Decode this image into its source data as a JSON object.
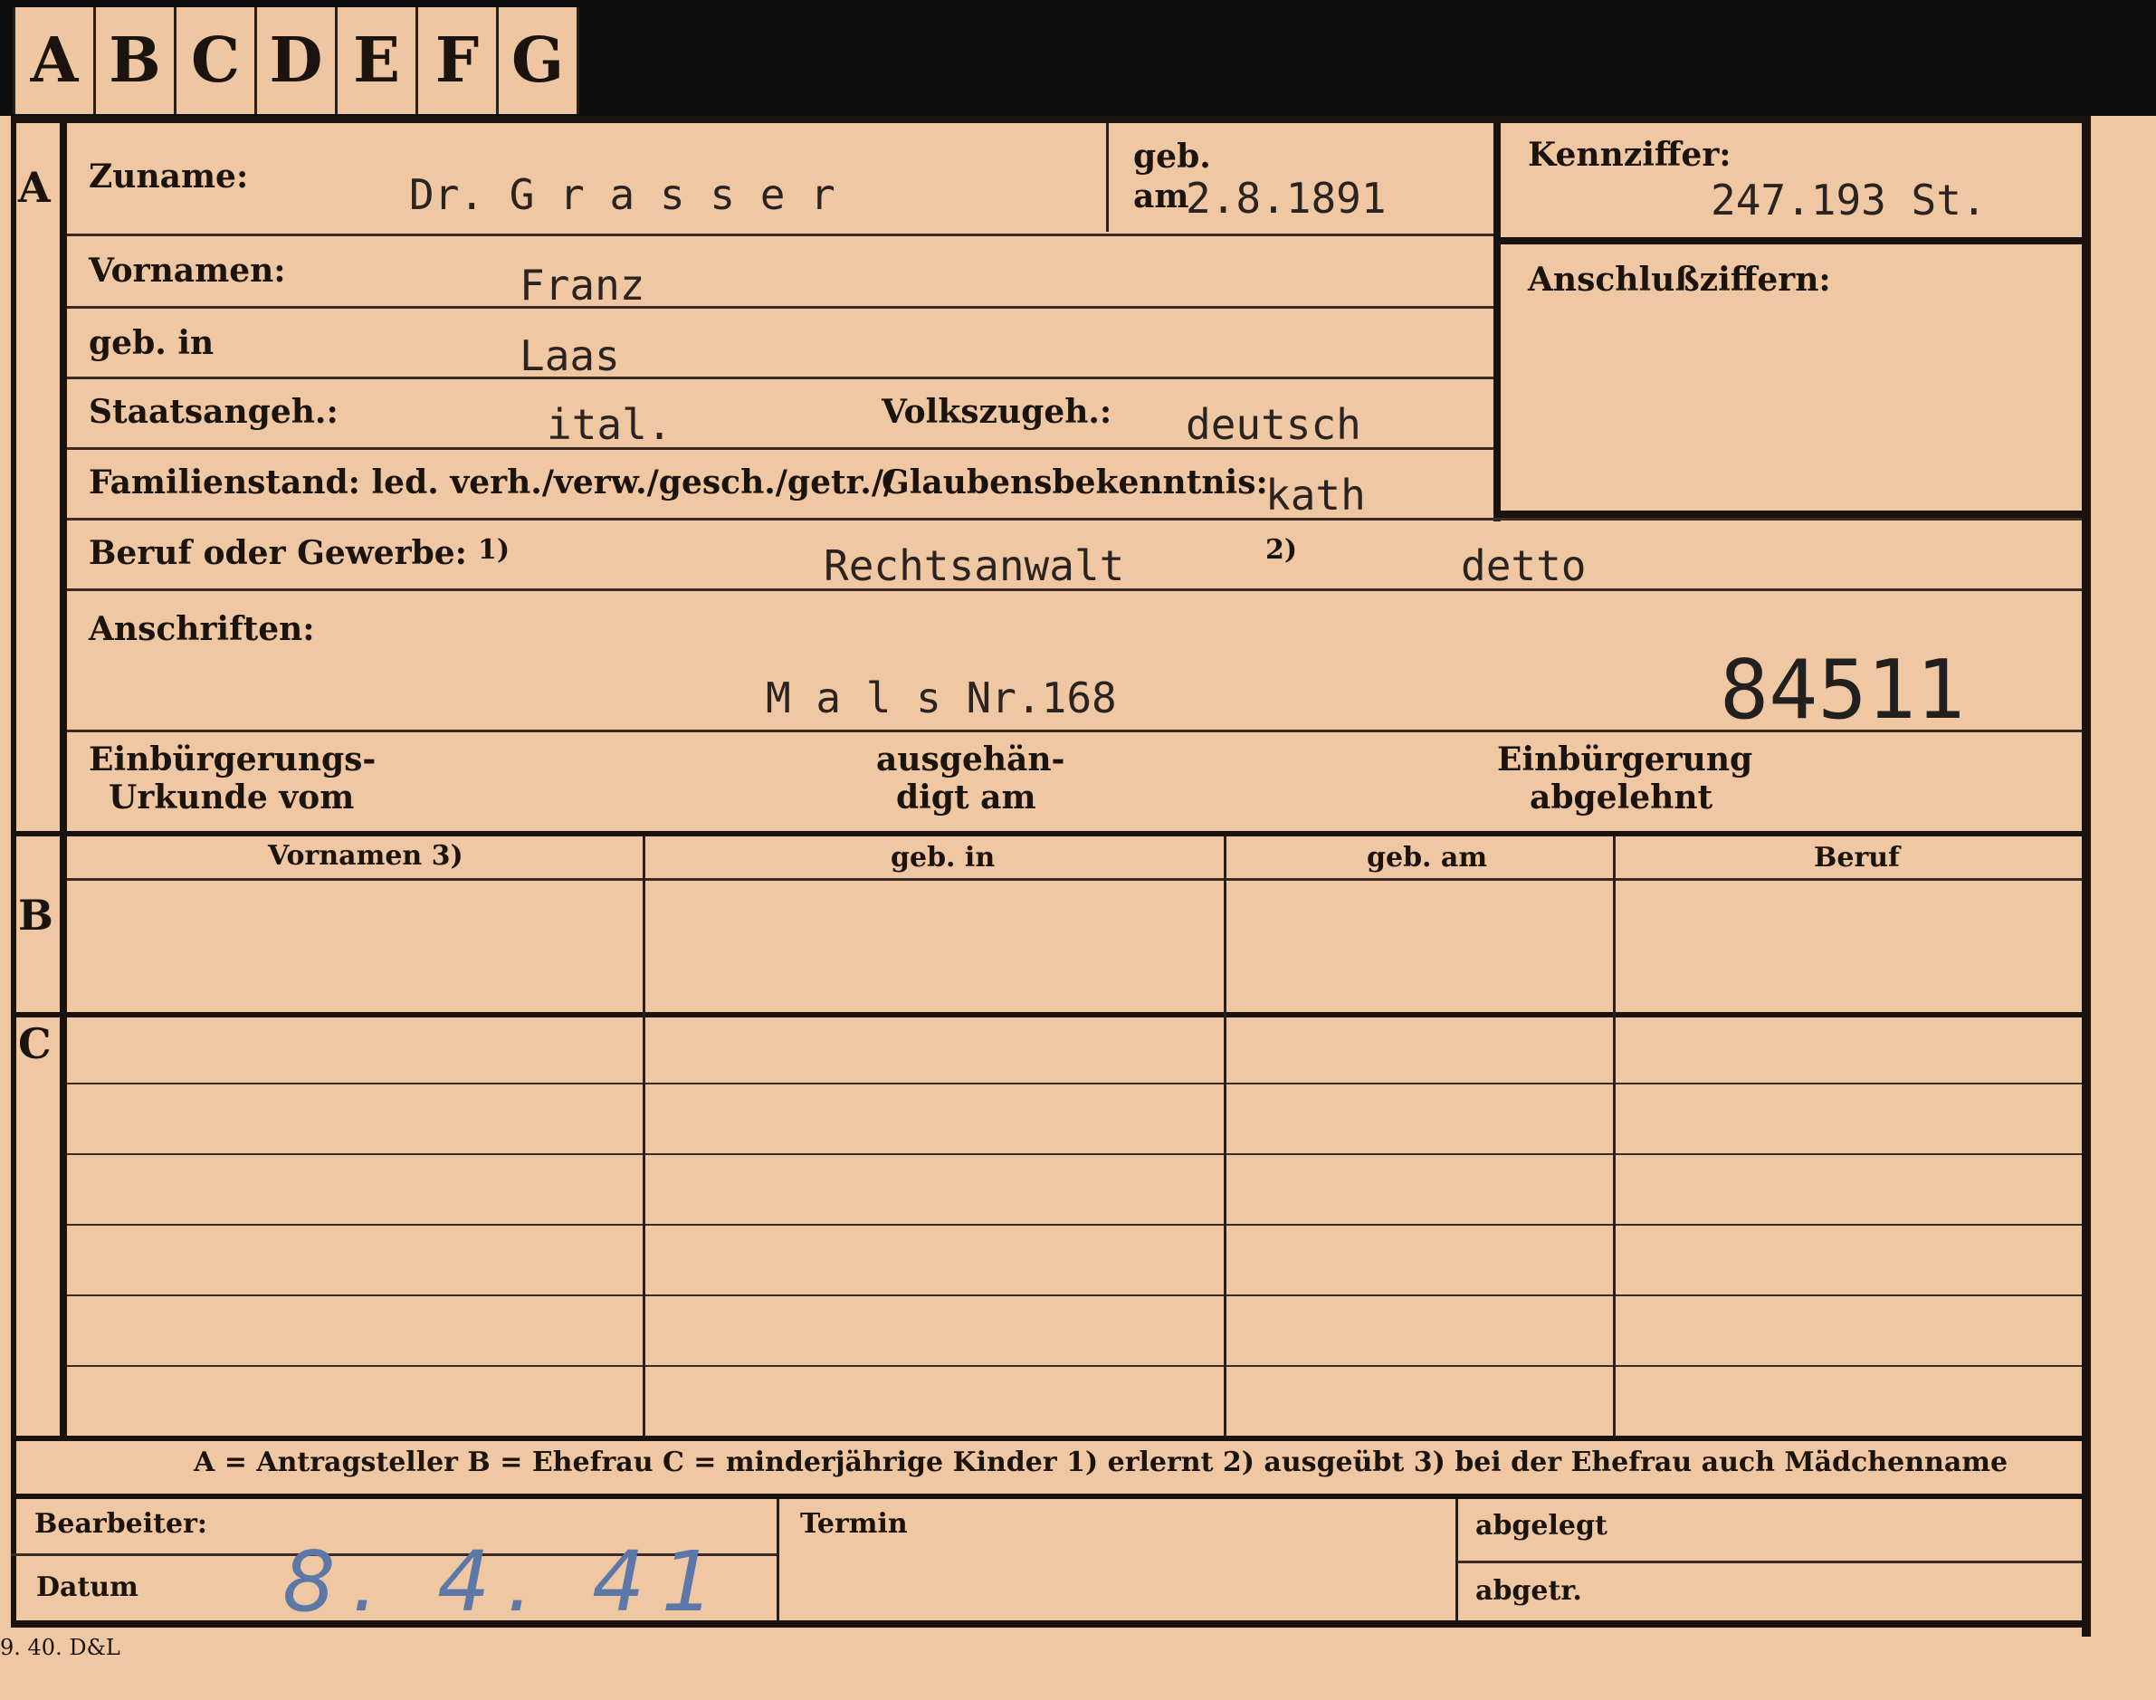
{
  "tabs": [
    "A",
    "B",
    "C",
    "D",
    "E",
    "F",
    "G"
  ],
  "sections": {
    "a": "A",
    "b": "B",
    "c": "C"
  },
  "labels": {
    "zuname": "Zuname:",
    "geb": "geb.",
    "am": "am",
    "kennziffer": "Kennziffer:",
    "anschlussziffern": "Anschlußziffern:",
    "vornamen": "Vornamen:",
    "geb_in": "geb. in",
    "staatsangeh": "Staatsangeh.:",
    "volkszugeh": "Volkszugeh.:",
    "familienstand": "Familienstand: led. verh./verw./gesch./getr.//",
    "glaubensbekenntnis": "Glaubensbekenntnis:",
    "beruf": "Beruf oder Gewerbe:",
    "fn1": "1)",
    "fn2": "2)",
    "anschriften": "Anschriften:",
    "einb_urkunde_1": "Einbürgerungs-",
    "einb_urkunde_2": "Urkunde vom",
    "ausgehaendigt_1": "ausgehän-",
    "ausgehaendigt_2": "digt am",
    "einb_abgelehnt_1": "Einbürgerung",
    "einb_abgelehnt_2": "abgelehnt"
  },
  "values": {
    "zuname": "Dr. G r a s s e r",
    "geb_am": "2.8.1891",
    "kennziffer": "247.193  St.",
    "vornamen": "Franz",
    "geb_in": "Laas",
    "staatsangeh": "ital.",
    "volkszugeh": "deutsch",
    "glaubensbekenntnis": "kath",
    "beruf_erlernt": "Rechtsanwalt",
    "beruf_ausgeuebt": "detto",
    "anschrift": "M a l s  Nr.168",
    "number": "84511"
  },
  "table_b": {
    "headers": [
      "Vornamen 3)",
      "geb. in",
      "geb. am",
      "Beruf"
    ]
  },
  "legend": "A = Antragsteller   B = Ehefrau   C = minderjährige Kinder   1) erlernt   2) ausgeübt   3) bei der Ehefrau auch Mädchenname",
  "footer": {
    "bearbeiter": "Bearbeiter:",
    "datum": "Datum",
    "datum_value": "8. 4. 41",
    "termin": "Termin",
    "abgelegt": "abgelegt",
    "abgetr": "abgetr.",
    "print_code": "9. 40. D&L"
  }
}
